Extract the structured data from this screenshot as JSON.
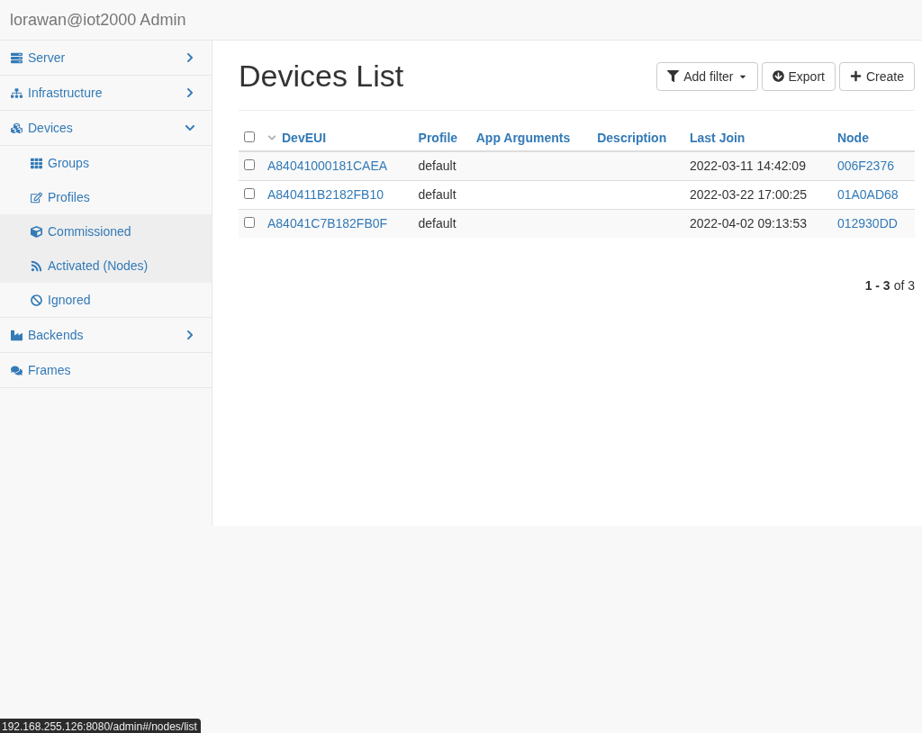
{
  "header": {
    "title": "lorawan@iot2000 Admin"
  },
  "sidebar": {
    "items": [
      {
        "label": "Server",
        "kind": "group",
        "expanded": false
      },
      {
        "label": "Infrastructure",
        "kind": "group",
        "expanded": false
      },
      {
        "label": "Devices",
        "kind": "group",
        "expanded": true,
        "children": [
          {
            "label": "Groups",
            "selected": false
          },
          {
            "label": "Profiles",
            "selected": false
          },
          {
            "label": "Commissioned",
            "selected": true
          },
          {
            "label": "Activated (Nodes)",
            "selected": true
          },
          {
            "label": "Ignored",
            "selected": false
          }
        ]
      },
      {
        "label": "Backends",
        "kind": "group",
        "expanded": false
      },
      {
        "label": "Frames",
        "kind": "link"
      }
    ]
  },
  "page": {
    "title": "Devices List",
    "buttons": [
      "Add filter",
      "Export",
      "Create"
    ]
  },
  "table": {
    "select_all_checked": false,
    "columns": [
      {
        "label": "DevEUI",
        "sorted": true
      },
      {
        "label": "Profile",
        "sorted": false
      },
      {
        "label": "App Arguments",
        "sorted": false
      },
      {
        "label": "Description",
        "sorted": false
      },
      {
        "label": "Last Join",
        "sorted": false
      },
      {
        "label": "Node",
        "sorted": false
      }
    ],
    "rows": [
      {
        "checked": false,
        "cells": [
          "A84041000181CAEA",
          "default",
          "",
          "",
          "2022-03-11 14:42:09",
          "006F2376"
        ]
      },
      {
        "checked": false,
        "cells": [
          "A840411B2182FB10",
          "default",
          "",
          "",
          "2022-03-22 17:00:25",
          "01A0AD68"
        ]
      },
      {
        "checked": false,
        "cells": [
          "A84041C7B182FB0F",
          "default",
          "",
          "",
          "2022-04-02 09:13:53",
          "012930DD"
        ]
      }
    ]
  },
  "pagination": {
    "range": "1 - 3",
    "of": "of 3"
  },
  "status_bar": {
    "url": "192.168.255.126:8080/admin#/nodes/list"
  }
}
